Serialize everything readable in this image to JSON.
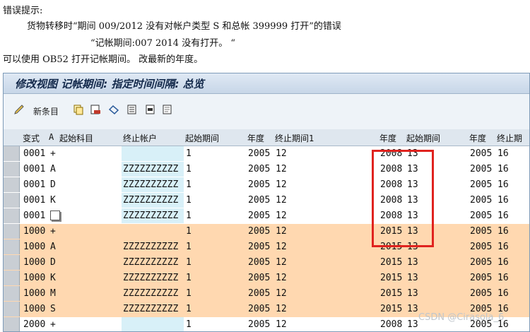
{
  "doc": {
    "line1": "错误提示:",
    "line2": "货物转移时“期间 009/2012 没有对帐户类型 S 和总帐 399999 打开”的错误",
    "line3": "“记帐期间:007 2014 没有打开。 “",
    "line4": "可以使用 OB52 打开记帐期间。 改最新的年度。"
  },
  "window": {
    "title": "修改视图 记帐期间: 指定时间间隔: 总览",
    "new_entries_label": "新条目"
  },
  "toolbar_icons": [
    "edit-icon",
    "copy-icon",
    "delete-icon",
    "undo-icon",
    "select-all-icon",
    "select-block-icon",
    "deselect-icon"
  ],
  "table": {
    "headers": [
      "变式",
      "A",
      "起始科目",
      "终止帐户",
      "起始期间",
      "年度",
      "终止期间1",
      "年度",
      "起始期间",
      "年度",
      "终止期"
    ],
    "rows": [
      [
        "0001",
        "+",
        "",
        "",
        "1",
        "2005",
        "12",
        "2008",
        "13",
        "2005",
        "16"
      ],
      [
        "0001",
        "A",
        "",
        "ZZZZZZZZZZ",
        "1",
        "2005",
        "12",
        "2008",
        "13",
        "2005",
        "16"
      ],
      [
        "0001",
        "D",
        "",
        "ZZZZZZZZZZ",
        "1",
        "2005",
        "12",
        "2008",
        "13",
        "2005",
        "16"
      ],
      [
        "0001",
        "K",
        "",
        "ZZZZZZZZZZ",
        "1",
        "2005",
        "12",
        "2008",
        "13",
        "2005",
        "16"
      ],
      [
        "0001",
        "",
        "",
        "ZZZZZZZZZZ",
        "1",
        "2005",
        "12",
        "2008",
        "13",
        "2005",
        "16"
      ],
      [
        "1000",
        "+",
        "",
        "",
        "1",
        "2005",
        "12",
        "2015",
        "13",
        "2005",
        "16"
      ],
      [
        "1000",
        "A",
        "",
        "ZZZZZZZZZZ",
        "1",
        "2005",
        "12",
        "2015",
        "13",
        "2005",
        "16"
      ],
      [
        "1000",
        "D",
        "",
        "ZZZZZZZZZZ",
        "1",
        "2005",
        "12",
        "2015",
        "13",
        "2005",
        "16"
      ],
      [
        "1000",
        "K",
        "",
        "ZZZZZZZZZZ",
        "1",
        "2005",
        "12",
        "2015",
        "13",
        "2005",
        "16"
      ],
      [
        "1000",
        "M",
        "",
        "ZZZZZZZZZZ",
        "1",
        "2005",
        "12",
        "2015",
        "13",
        "2005",
        "16"
      ],
      [
        "1000",
        "S",
        "",
        "ZZZZZZZZZZ",
        "1",
        "2005",
        "12",
        "2015",
        "13",
        "2005",
        "16"
      ],
      [
        "2000",
        "+",
        "",
        "",
        "1",
        "2005",
        "12",
        "2008",
        "13",
        "2005",
        "16"
      ]
    ]
  },
  "watermark": "CSDN @Cirasola_6",
  "colors": {
    "orange_row": "#ffd8b0",
    "blue_cell": "#d8f0f8",
    "highlight": "#e0231f"
  }
}
